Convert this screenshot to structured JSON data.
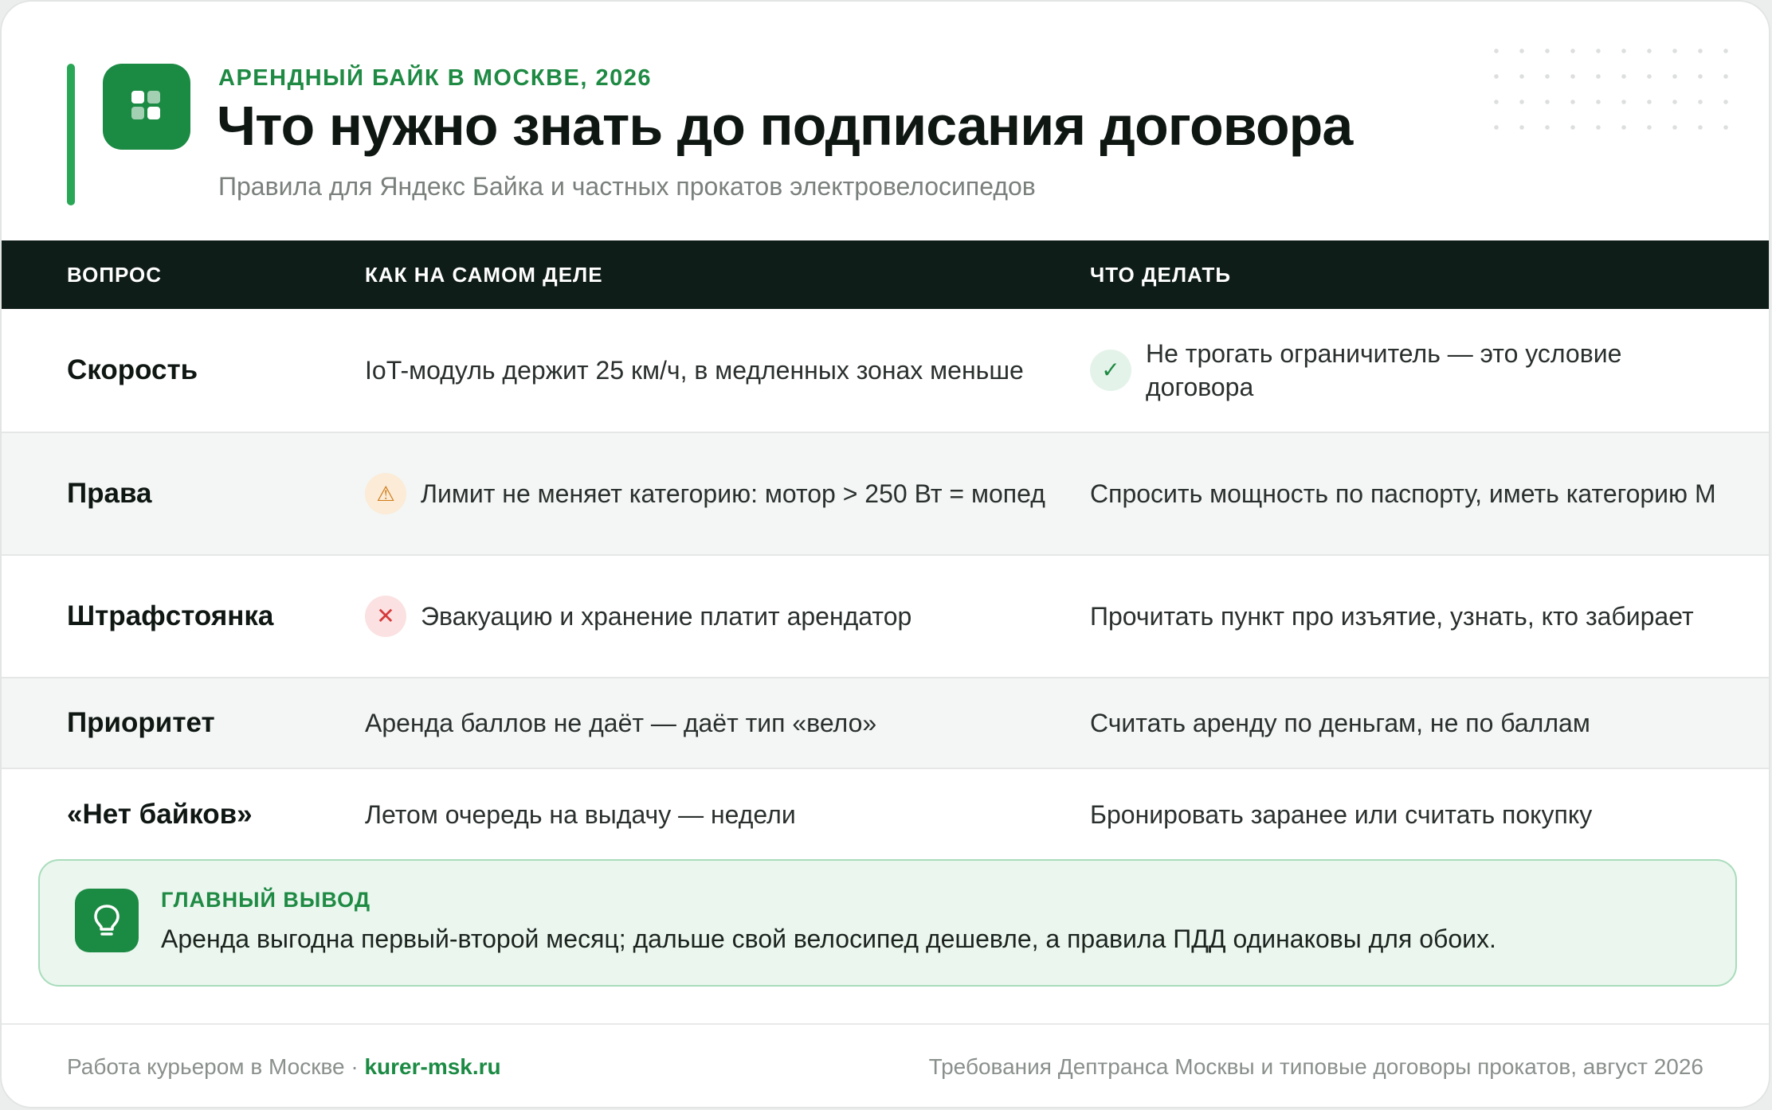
{
  "header": {
    "kicker": "АРЕНДНЫЙ БАЙК В МОСКВЕ, 2026",
    "title": "Что нужно знать до подписания договора",
    "subtitle": "Правила для Яндекс Байка и частных прокатов электровелосипедов",
    "logo_icon": "grid-icon"
  },
  "table": {
    "columns": [
      "ВОПРОС",
      "КАК НА САМОМ ДЕЛЕ",
      "ЧТО ДЕЛАТЬ"
    ],
    "rows": [
      {
        "question": "Скорость",
        "reality": "IoT-модуль держит 25 км/ч, в медленных зонах меньше",
        "action": "Не трогать ограничитель — это условие договора",
        "action_icon": "check-icon",
        "action_glyph": "✓"
      },
      {
        "question": "Права",
        "reality": "Лимит не меняет категорию: мотор > 250 Вт = мопед",
        "reality_icon": "warning-icon",
        "reality_glyph": "⚠",
        "action": "Спросить мощность по паспорту, иметь категорию М"
      },
      {
        "question": "Штрафстоянка",
        "reality": "Эвакуацию и хранение платит арендатор",
        "reality_icon": "cross-icon",
        "reality_glyph": "✕",
        "action": "Прочитать пункт про изъятие, узнать, кто забирает"
      },
      {
        "question": "Приоритет",
        "reality": "Аренда баллов не даёт — даёт тип «вело»",
        "action": "Считать аренду по деньгам, не по баллам"
      },
      {
        "question": "«Нет байков»",
        "reality": "Летом очередь на выдачу — недели",
        "action": "Бронировать заранее или считать покупку"
      }
    ]
  },
  "takeaway": {
    "label": "ГЛАВНЫЙ ВЫВОД",
    "text": "Аренда выгодна первый-второй месяц; дальше свой велосипед дешевле, а правила ПДД одинаковы для обоих.",
    "icon": "lightbulb-icon"
  },
  "footer": {
    "left_text": "Работа курьером в Москве · ",
    "link": "kurer-msk.ru",
    "right_text": "Требования Дептранса Москвы и типовые договоры прокатов, август 2026"
  },
  "colors": {
    "brand_green": "#1b8a43",
    "header_bar": "#0f1d18",
    "warning": "#d07a14",
    "danger": "#d63a3a"
  }
}
